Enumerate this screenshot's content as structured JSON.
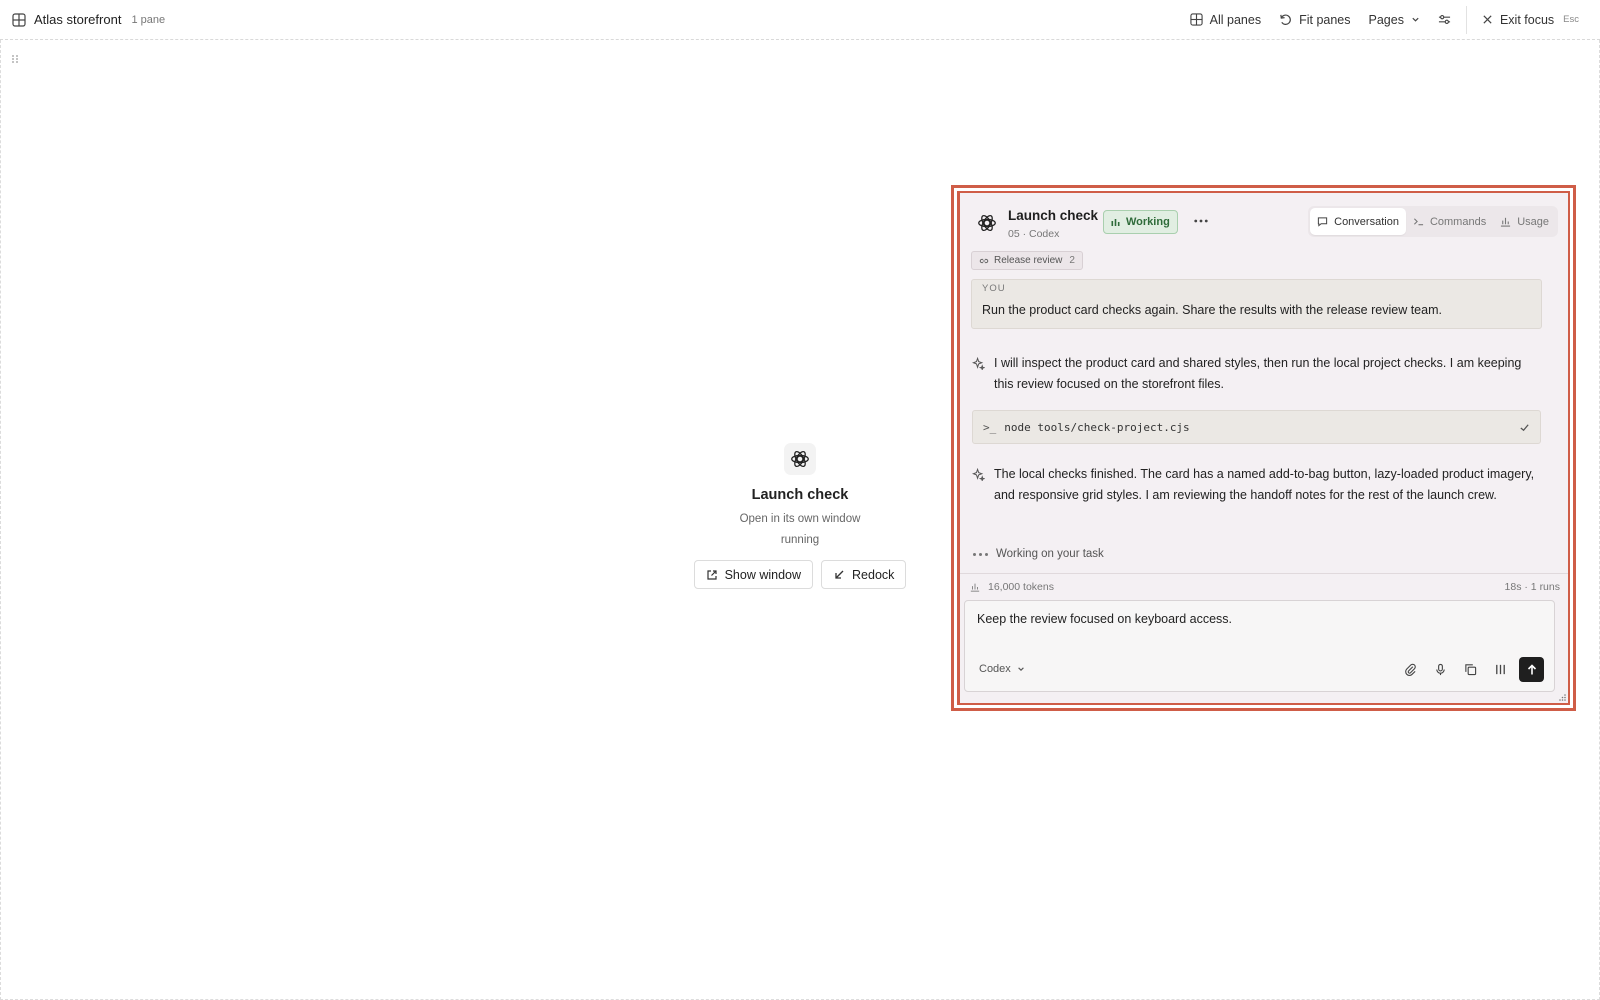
{
  "topbar": {
    "title": "Atlas storefront",
    "pane_count": "1 pane",
    "all_panes": "All panes",
    "fit_panes": "Fit panes",
    "pages": "Pages",
    "exit_focus": "Exit focus",
    "exit_shortcut": "Esc"
  },
  "placeholder": {
    "title": "Launch check",
    "subtitle": "Open in its own window",
    "status": "running",
    "show_window": "Show window",
    "redock": "Redock"
  },
  "panel": {
    "title": "Launch check",
    "meta": "05 · Codex",
    "status": "Working",
    "tabs": [
      {
        "label": "Conversation",
        "icon": "chat-bubble-icon",
        "active": true
      },
      {
        "label": "Commands",
        "icon": "terminal-icon",
        "active": false
      },
      {
        "label": "Usage",
        "icon": "bar-chart-icon",
        "active": false
      }
    ],
    "chip": {
      "label": "Release review",
      "count": "2"
    },
    "user_message": {
      "label": "YOU",
      "text": "Run the product card checks again. Share the results with the release review team."
    },
    "ai_message_1": "I will inspect the product card and shared styles, then run the local project checks. I am keeping this review focused on the storefront files.",
    "command": {
      "prompt": ">_",
      "text": "node tools/check-project.cjs"
    },
    "ai_message_2": "The local checks finished. The card has a named add-to-bag button, lazy-loaded product imagery, and responsive grid styles. I am reviewing the handoff notes for the rest of the launch crew.",
    "working_text": "Working on your task",
    "tokens": "16,000 tokens",
    "run_stats": "18s · 1 runs",
    "composer": {
      "text": "Keep the review focused on keyboard access.",
      "model": "Codex"
    }
  },
  "colors": {
    "focus_outline": "#cf5d47",
    "panel_bg": "#f4f0f3",
    "status_green": "#2f6b3a",
    "status_bg": "#e1eee2"
  }
}
